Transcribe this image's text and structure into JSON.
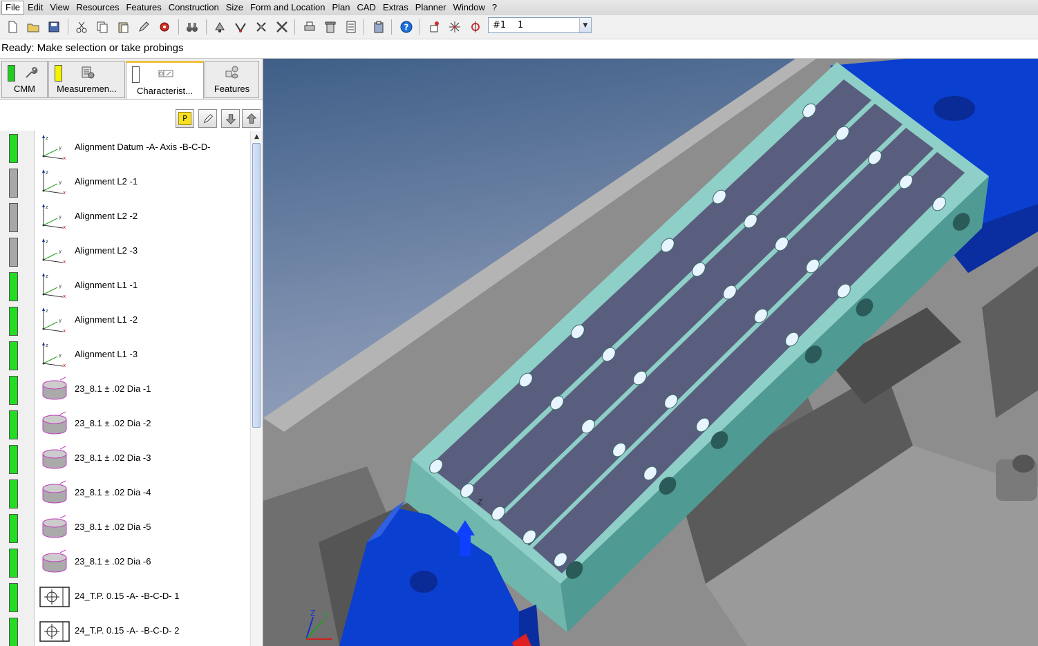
{
  "menu": [
    "File",
    "Edit",
    "View",
    "Resources",
    "Features",
    "Construction",
    "Size",
    "Form and Location",
    "Plan",
    "CAD",
    "Extras",
    "Planner",
    "Window",
    "?"
  ],
  "toolbar": {
    "icons": [
      "new-file-icon",
      "open-folder-icon",
      "save-icon",
      "cut-icon",
      "copy-icon",
      "paste-icon",
      "edit-icon",
      "record-icon",
      "binoculars-icon",
      "probe-icon",
      "probe-alt-icon",
      "probe-config-icon",
      "tools-icon",
      "print-icon",
      "delete-icon",
      "report-icon",
      "clipboard-icon",
      "help-icon",
      "hand-probe-icon",
      "star-probe-icon",
      "probe-target-icon"
    ],
    "combo_prefix": "#1",
    "combo_value": "1"
  },
  "status": "Ready: Make selection or take probings",
  "tabs": [
    {
      "label": "CMM",
      "indicator": "#22cc22"
    },
    {
      "label": "Measuremen...",
      "indicator": "#f4f400"
    },
    {
      "label": "Characterist...",
      "indicator": "#ffffff"
    },
    {
      "label": "Features",
      "indicator": ""
    }
  ],
  "subbar": {
    "p_label": "P"
  },
  "items": [
    {
      "icon": "alignment-axes-icon",
      "label": "Alignment Datum -A- Axis -B-C-D-",
      "status": "green"
    },
    {
      "icon": "alignment-axes-icon",
      "label": "Alignment L2 -1",
      "status": "gray"
    },
    {
      "icon": "alignment-axes-icon",
      "label": "Alignment L2 -2",
      "status": "gray"
    },
    {
      "icon": "alignment-axes-icon",
      "label": "Alignment L2 -3",
      "status": "gray"
    },
    {
      "icon": "alignment-axes-icon",
      "label": "Alignment L1 -1",
      "status": "green"
    },
    {
      "icon": "alignment-axes-icon",
      "label": "Alignment L1 -2",
      "status": "green"
    },
    {
      "icon": "alignment-axes-icon",
      "label": "Alignment L1 -3",
      "status": "green"
    },
    {
      "icon": "cylinder-diameter-icon",
      "label": "23_8.1 ± .02 Dia -1",
      "status": "green"
    },
    {
      "icon": "cylinder-diameter-icon",
      "label": "23_8.1 ± .02 Dia -2",
      "status": "green"
    },
    {
      "icon": "cylinder-diameter-icon",
      "label": "23_8.1 ± .02 Dia -3",
      "status": "green"
    },
    {
      "icon": "cylinder-diameter-icon",
      "label": "23_8.1 ± .02 Dia -4",
      "status": "green"
    },
    {
      "icon": "cylinder-diameter-icon",
      "label": "23_8.1 ± .02 Dia -5",
      "status": "green"
    },
    {
      "icon": "cylinder-diameter-icon",
      "label": "23_8.1 ± .02 Dia -6",
      "status": "green"
    },
    {
      "icon": "true-position-icon",
      "label": "24_T.P. 0.15 -A- -B-C-D- 1",
      "status": "green"
    },
    {
      "icon": "true-position-icon",
      "label": "24_T.P. 0.15 -A- -B-C-D- 2",
      "status": "green"
    }
  ],
  "colors": {
    "green": "#22dd22",
    "gray": "#a8a8a8",
    "part_teal": "#7fc4bc",
    "fixture_blue": "#0a3fd0",
    "fixture_gray": "#8d8d8d"
  },
  "viewport": {
    "axis_z": "Z",
    "axis_y": "Y",
    "probe_label": "Z"
  }
}
